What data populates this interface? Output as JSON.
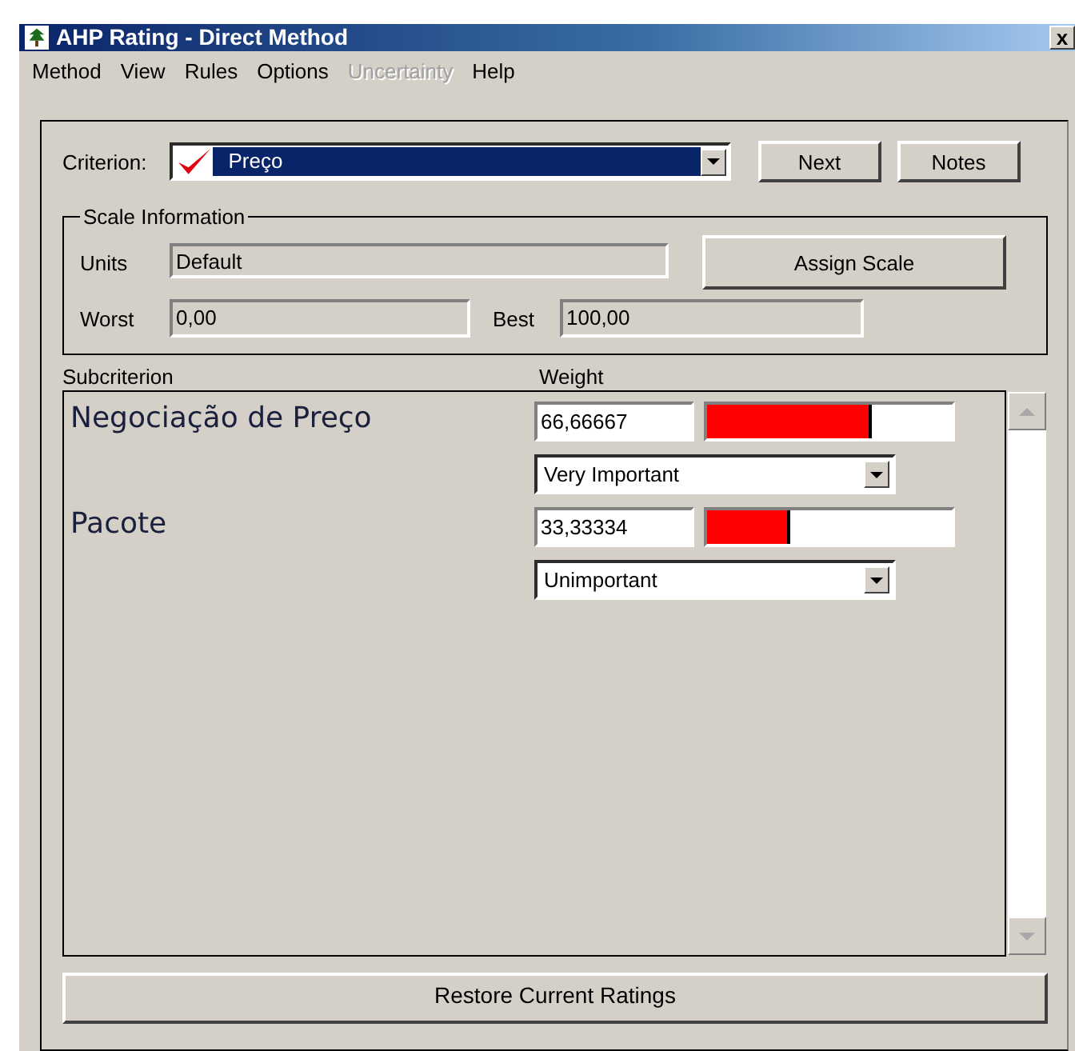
{
  "window": {
    "title": "AHP Rating - Direct Method",
    "close": "x"
  },
  "menu": [
    {
      "label": "Method",
      "disabled": false
    },
    {
      "label": "View",
      "disabled": false
    },
    {
      "label": "Rules",
      "disabled": false
    },
    {
      "label": "Options",
      "disabled": false
    },
    {
      "label": "Uncertainty",
      "disabled": true
    },
    {
      "label": "Help",
      "disabled": false
    }
  ],
  "criterion": {
    "label": "Criterion:",
    "value": "Preço",
    "checked": true,
    "buttons": [
      "Next",
      "Notes"
    ]
  },
  "scale_information": {
    "title": "Scale Information",
    "units_label": "Units",
    "units": "Default",
    "assign_button": "Assign Scale",
    "worst_label": "Worst",
    "worst": "0,00",
    "best_label": "Best",
    "best": "100,00"
  },
  "columns": [
    "Subcriterion",
    "Weight"
  ],
  "subcriteria": [
    {
      "name": "Negociação de Preço",
      "weight": "66,66667",
      "level": 0.67,
      "rating": "Very Important"
    },
    {
      "name": "Pacote",
      "weight": "33,33334",
      "level": 0.34,
      "rating": "Unimportant"
    }
  ],
  "restore_button": "Restore Current Ratings"
}
